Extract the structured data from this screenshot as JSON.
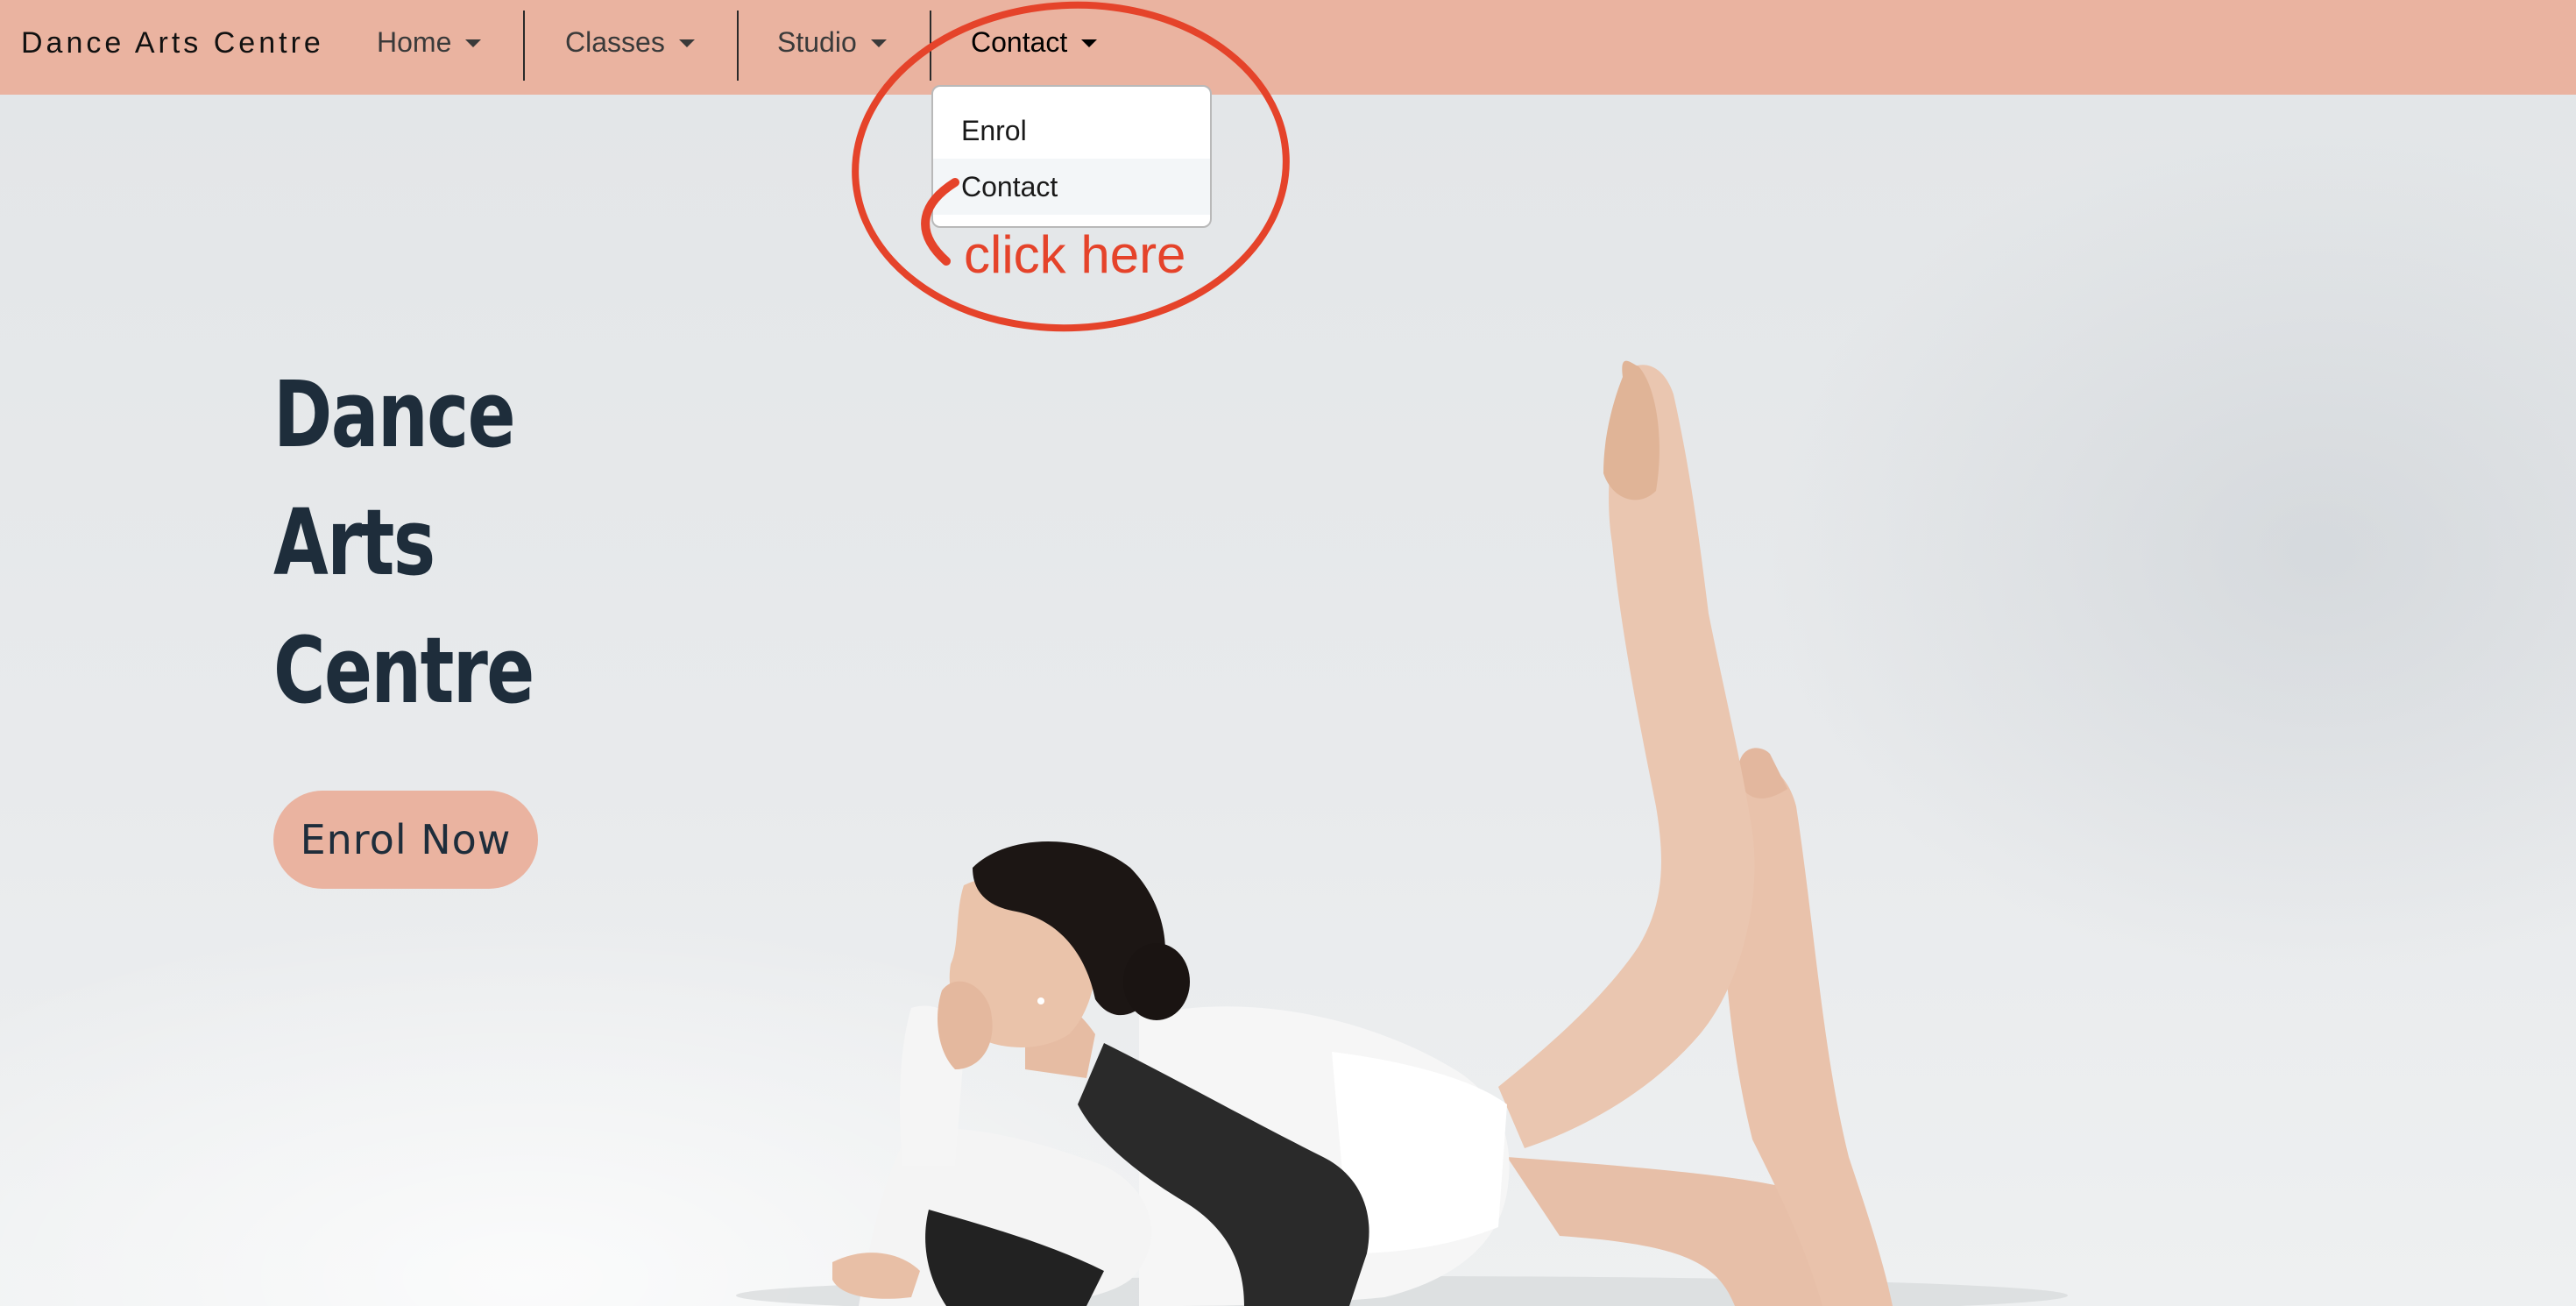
{
  "navbar": {
    "brand": "Dance Arts Centre",
    "items": [
      {
        "label": "Home"
      },
      {
        "label": "Classes"
      },
      {
        "label": "Studio"
      },
      {
        "label": "Contact"
      }
    ],
    "active": "Contact"
  },
  "dropdown": {
    "items": [
      {
        "label": "Enrol"
      },
      {
        "label": "Contact"
      }
    ],
    "highlighted": "Contact"
  },
  "annotation": {
    "text": "click here",
    "color": "#e5432a"
  },
  "hero": {
    "title_lines": [
      "Dance",
      "Arts",
      "Centre"
    ],
    "cta_label": "Enrol Now"
  },
  "colors": {
    "navbar_bg": "#eab3a0",
    "heading": "#1e2d3b",
    "button_bg": "#eab3a0"
  }
}
